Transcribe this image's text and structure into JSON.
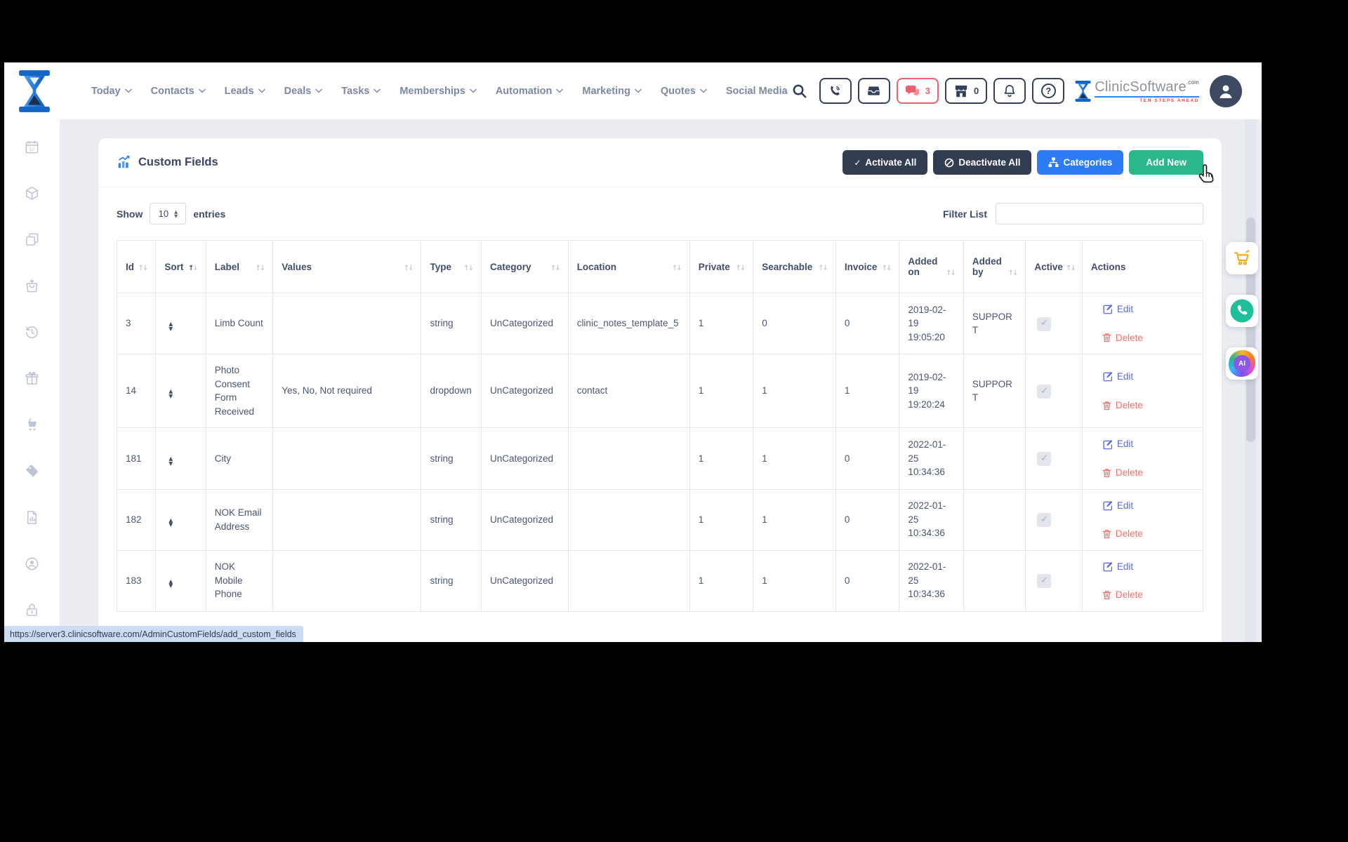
{
  "brand": {
    "clinic": "Clinic",
    "software": "Software",
    "dotcom": ".com",
    "tagline": "TEN STEPS AHEAD"
  },
  "topnav": [
    {
      "label": "Today",
      "chevron": true
    },
    {
      "label": "Contacts",
      "chevron": true
    },
    {
      "label": "Leads",
      "chevron": true
    },
    {
      "label": "Deals",
      "chevron": true
    },
    {
      "label": "Tasks",
      "chevron": true
    },
    {
      "label": "Memberships",
      "chevron": true
    },
    {
      "label": "Automation",
      "chevron": true
    },
    {
      "label": "Marketing",
      "chevron": true
    },
    {
      "label": "Quotes",
      "chevron": true
    },
    {
      "label": "Social Media",
      "chevron": false
    }
  ],
  "topbar": {
    "chat_count": "3",
    "store_count": "0",
    "help_glyph": "?"
  },
  "page": {
    "title": "Custom Fields",
    "buttons": {
      "activate": "Activate All",
      "deactivate": "Deactivate All",
      "categories": "Categories",
      "add_new": "Add New"
    }
  },
  "controls": {
    "show": "Show",
    "page_size": "10",
    "entries": "entries",
    "filter_label": "Filter List",
    "filter_value": ""
  },
  "icons": {
    "check": "✓",
    "asc": "▲",
    "desc": "▼",
    "sort_up": "↑",
    "sort_down": "↓",
    "ai": "AI"
  },
  "table": {
    "columns": [
      {
        "key": "id",
        "label": "Id",
        "arrows": true
      },
      {
        "key": "sort",
        "label": "Sort",
        "arrows": true,
        "sorted": "asc"
      },
      {
        "key": "label",
        "label": "Label",
        "arrows": true
      },
      {
        "key": "values",
        "label": "Values",
        "arrows": true
      },
      {
        "key": "type",
        "label": "Type",
        "arrows": true
      },
      {
        "key": "category",
        "label": "Category",
        "arrows": true
      },
      {
        "key": "location",
        "label": "Location",
        "arrows": true
      },
      {
        "key": "private",
        "label": "Private",
        "arrows": true
      },
      {
        "key": "searchable",
        "label": "Searchable",
        "arrows": true
      },
      {
        "key": "invoice",
        "label": "Invoice",
        "arrows": true
      },
      {
        "key": "added_on",
        "label": "Added on",
        "arrows": true
      },
      {
        "key": "added_by",
        "label": "Added by",
        "arrows": true
      },
      {
        "key": "active",
        "label": "Active",
        "arrows": true
      },
      {
        "key": "actions",
        "label": "Actions",
        "arrows": false
      }
    ],
    "rows": [
      {
        "id": "3",
        "label": "Limb Count",
        "values": "",
        "type": "string",
        "category": "UnCategorized",
        "location": "clinic_notes_template_5",
        "private": "1",
        "searchable": "0",
        "invoice": "0",
        "added_on": "2019-02-19 19:05:20",
        "added_by": "SUPPORT",
        "active": true
      },
      {
        "id": "14",
        "label": "Photo Consent Form Received",
        "values": "Yes, No, Not required",
        "type": "dropdown",
        "category": "UnCategorized",
        "location": "contact",
        "private": "1",
        "searchable": "1",
        "invoice": "1",
        "added_on": "2019-02-19 19:20:24",
        "added_by": "SUPPORT",
        "active": true
      },
      {
        "id": "181",
        "label": "City",
        "values": "",
        "type": "string",
        "category": "UnCategorized",
        "location": "",
        "private": "1",
        "searchable": "1",
        "invoice": "0",
        "added_on": "2022-01-25 10:34:36",
        "added_by": "",
        "active": true
      },
      {
        "id": "182",
        "label": "NOK Email Address",
        "values": "",
        "type": "string",
        "category": "UnCategorized",
        "location": "",
        "private": "1",
        "searchable": "1",
        "invoice": "0",
        "added_on": "2022-01-25 10:34:36",
        "added_by": "",
        "active": true
      },
      {
        "id": "183",
        "label": "NOK Mobile Phone",
        "values": "",
        "type": "string",
        "category": "UnCategorized",
        "location": "",
        "private": "1",
        "searchable": "1",
        "invoice": "0",
        "added_on": "2022-01-25 10:34:36",
        "added_by": "",
        "active": true
      }
    ],
    "actions": {
      "edit": "Edit",
      "delete": "Delete"
    }
  },
  "statusbar": {
    "url": "https://server3.clinicsoftware.com/AdminCustomFields/add_custom_fields"
  },
  "sidebar": {
    "items": [
      "calendar",
      "package",
      "copy",
      "orders",
      "history",
      "gift",
      "cart",
      "tags",
      "reports",
      "account",
      "security"
    ]
  },
  "floating": {
    "items": [
      "cart",
      "whatsapp",
      "ai"
    ]
  },
  "colors": {
    "dark_button": "#323d52",
    "blue_button": "#2d7cf6",
    "green_button": "#2ab78c",
    "alert": "#ef5f6f",
    "link_edit": "#5a68e8",
    "link_delete": "#f4716c",
    "brand_blue": "#2e86f2"
  }
}
